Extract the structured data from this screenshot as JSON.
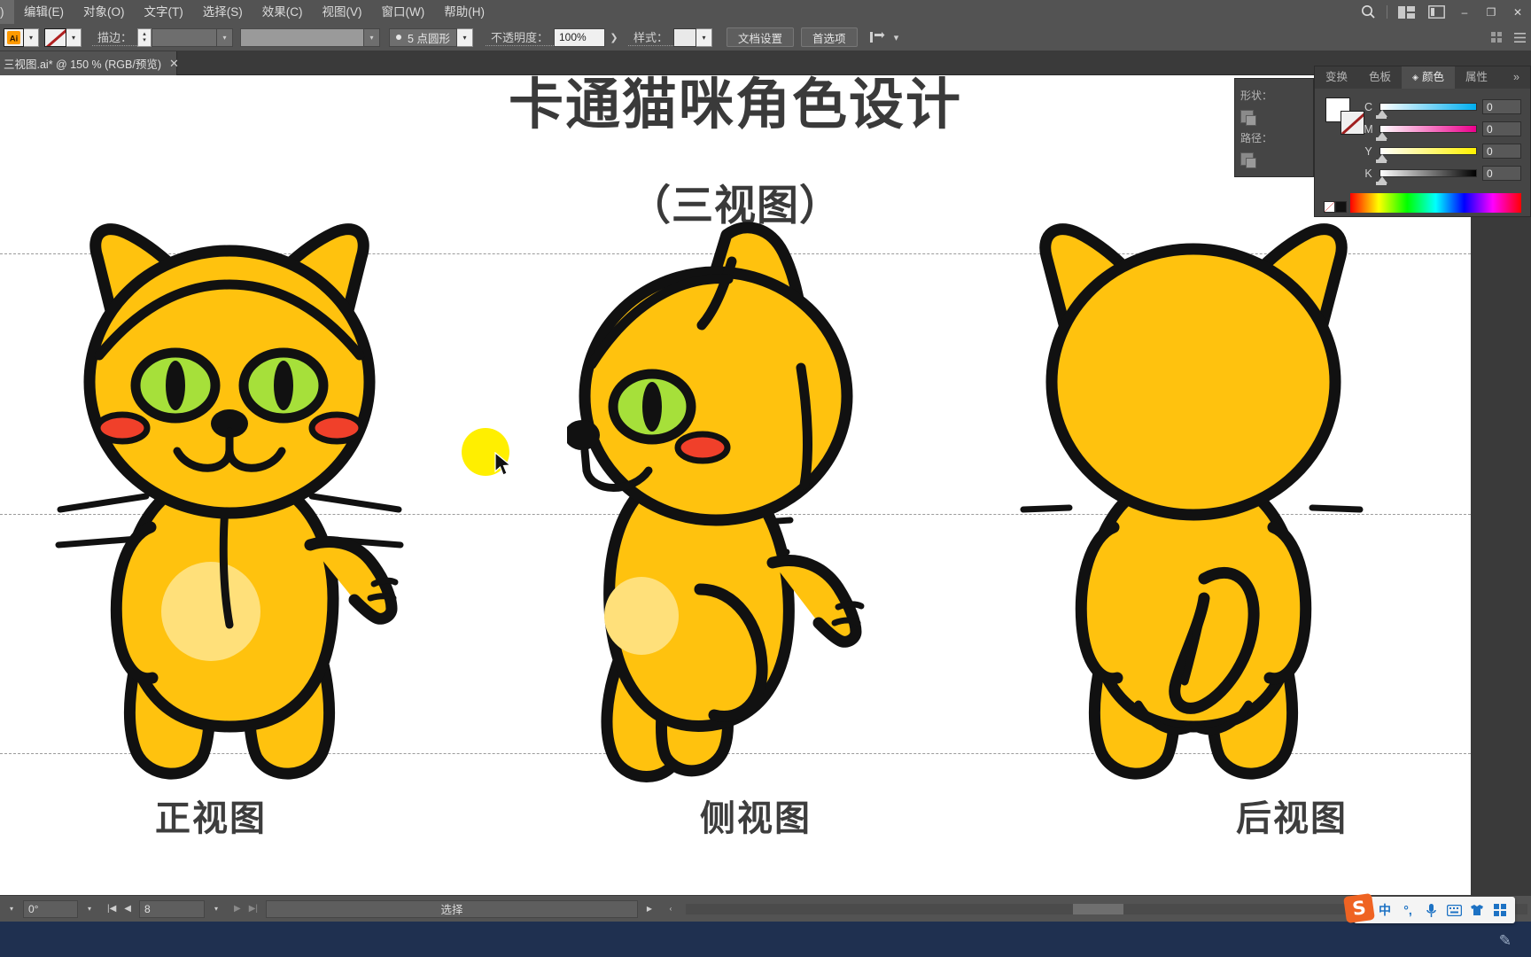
{
  "app": {
    "name": "Adobe Illustrator"
  },
  "menubar": {
    "items": [
      {
        "label": ")",
        "name": "menu-file-clipped"
      },
      {
        "label": "编辑(E)",
        "name": "menu-edit"
      },
      {
        "label": "对象(O)",
        "name": "menu-object"
      },
      {
        "label": "文字(T)",
        "name": "menu-type"
      },
      {
        "label": "选择(S)",
        "name": "menu-select"
      },
      {
        "label": "效果(C)",
        "name": "menu-effect"
      },
      {
        "label": "视图(V)",
        "name": "menu-view"
      },
      {
        "label": "窗口(W)",
        "name": "menu-window"
      },
      {
        "label": "帮助(H)",
        "name": "menu-help"
      }
    ],
    "search_icon": "search-icon",
    "workspace_icon": "workspace-switcher-icon",
    "arrange_icon": "arrange-documents-icon",
    "window_minimize": "–",
    "window_restore": "❐",
    "window_close": "✕"
  },
  "controlbar": {
    "fill_swatch_label": "no-fill",
    "stroke_label": "描边：",
    "stroke_weight_value": "",
    "stroke_profile_value": "",
    "stroke_style_label": "5 点圆形",
    "opacity_label": "不透明度：",
    "opacity_value": "100%",
    "style_label": "样式：",
    "doc_setup_button": "文档设置",
    "preferences_button": "首选项",
    "align_icon": "align-objects-icon"
  },
  "tab": {
    "title": "三视图.ai* @ 150 % (RGB/预览)",
    "close": "✕"
  },
  "canvas": {
    "artboard_title": "卡通猫咪角色设计",
    "artboard_subtitle": "（三视图）",
    "view_labels": [
      {
        "text": "正视图",
        "name": "label-front-view"
      },
      {
        "text": "侧视图",
        "name": "label-side-view"
      },
      {
        "text": "后视图",
        "name": "label-back-view"
      }
    ],
    "guides_count": 3,
    "colors": {
      "body": "#FFC20E",
      "belly": "#FFE07A",
      "outline": "#111111",
      "eye": "#A6E03A",
      "pupil": "#111111",
      "cheek": "#F0402A",
      "guide": "#9B9B9B",
      "selection_object": "#FFEF00"
    }
  },
  "panels": {
    "left_group": {
      "shape_label": "形状：",
      "path_label": "路径：",
      "icons": [
        "shape-builder-icon",
        "unite-icon",
        "revert-icon",
        "path-icon"
      ]
    },
    "tabs_secondary": [
      {
        "label": "变换",
        "name": "tab-transform",
        "active": false
      },
      {
        "label": "色板",
        "name": "tab-swatches",
        "active": false
      }
    ],
    "color_panel": {
      "tabs": [
        {
          "label": "颜色",
          "name": "tab-color",
          "active": true
        },
        {
          "label": "属性",
          "name": "tab-properties",
          "active": false
        }
      ],
      "overflow": "»",
      "channels": [
        {
          "key": "C",
          "value": "0",
          "track_from": "#ffffff",
          "track_to": "#00aeef"
        },
        {
          "key": "M",
          "value": "0",
          "track_from": "#ffffff",
          "track_to": "#ec008c"
        },
        {
          "key": "Y",
          "value": "0",
          "track_from": "#ffffff",
          "track_to": "#fff200"
        },
        {
          "key": "K",
          "value": "0",
          "track_from": "#ffffff",
          "track_to": "#000000"
        }
      ]
    }
  },
  "statusbar": {
    "rotation_value": "0°",
    "artboard_value": "8",
    "status_text": "选择",
    "nav_first": "|◀",
    "nav_prev": "◀",
    "nav_next": "▶",
    "nav_last": "▶|",
    "expand": "▶",
    "collapse": "‹"
  },
  "ime": {
    "name": "Sogou Pinyin",
    "logo": "S",
    "mode": "中",
    "punctuation": "°,",
    "items": [
      {
        "glyph": "中",
        "name": "ime-mode-chinese"
      },
      {
        "glyph": "°,",
        "name": "ime-punctuation"
      },
      {
        "glyph": "🎤",
        "name": "ime-voice-icon"
      },
      {
        "glyph": "⌨",
        "name": "ime-keyboard-icon"
      },
      {
        "glyph": "👕",
        "name": "ime-skin-icon"
      },
      {
        "glyph": "▦",
        "name": "ime-toolbox-icon"
      }
    ]
  }
}
